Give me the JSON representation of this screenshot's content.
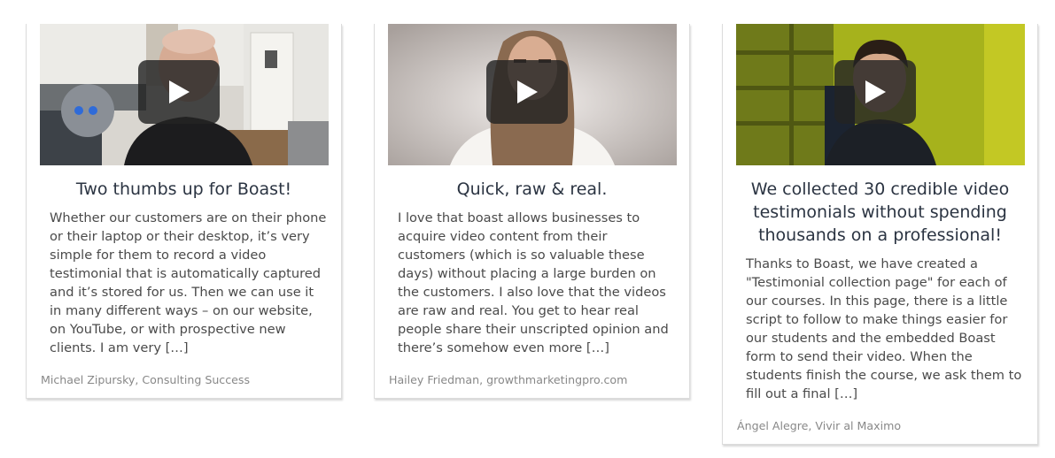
{
  "cards": [
    {
      "title": "Two thumbs up for Boast!",
      "body": "Whether our customers are on their phone or their laptop or their desktop, it’s very simple for them to record a video testimonial that is automatically captured and it’s stored for us. Then we can use it in many different ways – on our website, on YouTube, or with prospective new clients. I am very ",
      "more": "[…]",
      "author": "Michael Zipursky, Consulting Success"
    },
    {
      "title": "Quick, raw & real.",
      "body": "I love that boast allows businesses to acquire video content from their customers (which is so valuable these days) without placing a large burden on the customers. I also love that the videos are raw and real. You get to hear real people share their unscripted opinion and there’s somehow even more ",
      "more": "[…]",
      "author": "Hailey Friedman, growthmarketingpro.com"
    },
    {
      "title": "We collected 30 credible video testimonials without spending thousands on a professional!",
      "body": "Thanks to Boast, we have created a \"Testimonial collection page\" for each of our courses. In this page, there is a little script to follow to make things easier for our students and the embedded Boast form to send their video. When the students finish the course, we ask them to fill out a final ",
      "more": "[…]",
      "author": "Ángel Alegre, Vivir al Maximo"
    }
  ],
  "icons": {
    "play": "play-icon"
  },
  "colors": {
    "title": "#2b3442",
    "body": "#4a4a4a",
    "author": "#888888",
    "play_bg": "#232323"
  }
}
